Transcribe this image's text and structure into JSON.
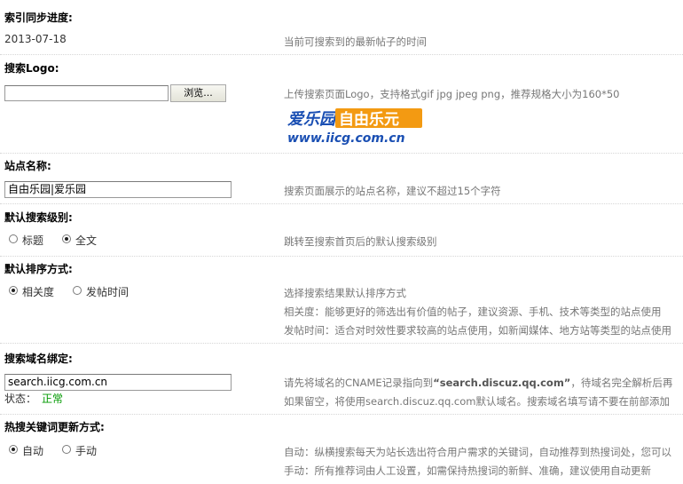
{
  "index_sync": {
    "label": "索引同步进度:",
    "value": "2013-07-18",
    "hint": "当前可搜索到的最新帖子的时间"
  },
  "search_logo": {
    "label": "搜索Logo:",
    "browse_label": "浏览...",
    "hint": "上传搜索页面Logo，支持格式gif jpg jpeg png，推荐规格大小为160*50",
    "logo": {
      "text_top_left": "爱乐园",
      "text_top_right": "自由乐元",
      "text_bottom": "www.iicg.com.cn",
      "colors": {
        "blue": "#1a4fb3",
        "orange": "#f39a12",
        "red": "#e0241b"
      }
    }
  },
  "site_name": {
    "label": "站点名称:",
    "value": "自由乐园|爱乐园",
    "hint": "搜索页面展示的站点名称，建议不超过15个字符"
  },
  "default_level": {
    "label": "默认搜索级别:",
    "options": [
      "标题",
      "全文"
    ],
    "selected": "全文",
    "hint": "跳转至搜索首页后的默认搜索级别"
  },
  "sort_order": {
    "label": "默认排序方式:",
    "options": [
      "相关度",
      "发帖时间"
    ],
    "selected": "相关度",
    "hints": [
      "选择搜索结果默认排序方式",
      "相关度：能够更好的筛选出有价值的帖子，建议资源、手机、技术等类型的站点使用",
      "发帖时间：适合对时效性要求较高的站点使用，如新闻媒体、地方站等类型的站点使用"
    ]
  },
  "domain_bind": {
    "label": "搜索域名绑定:",
    "value": "search.iicg.com.cn",
    "status_label": "状态：",
    "status_value": "正常",
    "hint1_pre": "请先将域名的CNAME记录指向到",
    "hint1_quoted": "“search.discuz.qq.com”",
    "hint1_post": "，待域名完全解析后再",
    "hint2": "如果留空，将使用search.discuz.qq.com默认域名。搜索域名填写请不要在前部添加"
  },
  "hot_keywords": {
    "label": "热搜关键词更新方式:",
    "options": [
      "自动",
      "手动"
    ],
    "selected": "自动",
    "hints": [
      "自动：纵横搜索每天为站长选出符合用户需求的关键词，自动推荐到热搜词处，您可以",
      "手动：所有推荐词由人工设置，如需保持热搜词的新鲜、准确，建议使用自动更新"
    ]
  }
}
